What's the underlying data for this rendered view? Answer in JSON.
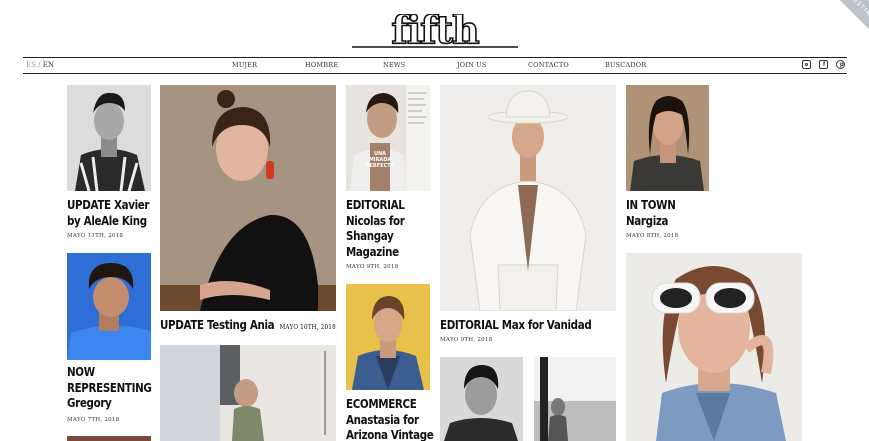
{
  "brand": {
    "logo_text": "fifth"
  },
  "ribbon": {
    "label": "TESTING"
  },
  "nav": {
    "lang_inactive": "ES",
    "lang_separator": "/",
    "lang_active": "EN",
    "items": [
      "MUJER",
      "HOMBRE",
      "NEWS",
      "JOIN US",
      "CONTACTO",
      "BUSCADOR"
    ],
    "social": [
      "instagram-icon",
      "facebook-icon",
      "pinterest-icon"
    ]
  },
  "posts": [
    {
      "title_lines": [
        "UPDATE Xavier",
        "by AleAle King"
      ],
      "date": "MAYO 11TH, 2018"
    },
    {
      "title_lines": [
        "NOW",
        "REPRESENTING",
        "Gregory"
      ],
      "date": "MAYO 7TH, 2018"
    },
    {
      "title": "UPDATE Testing Ania",
      "date": "MAYO 10TH, 2018"
    },
    {
      "title_lines": [
        "EDITORIAL",
        "Nicolas for",
        "Shangay",
        "Magazine"
      ],
      "date": "MAYO 9TH, 2018"
    },
    {
      "title_lines": [
        "ECOMMERCE",
        "Anastasia for",
        "Arizona Vintage"
      ]
    },
    {
      "title": "EDITORIAL Max for Vanidad",
      "date": "MAYO 9TH, 2018"
    },
    {
      "title_lines": [
        "IN TOWN",
        "Nargiza"
      ],
      "date": "MAYO 8TH, 2018"
    }
  ],
  "magazine_cover_text": [
    "UNA",
    "MIRADA",
    "PERFECTA"
  ],
  "colors": {
    "text": "#111111",
    "rule": "#222222",
    "muted": "#999999",
    "ribbon": "#b9c4c9"
  }
}
